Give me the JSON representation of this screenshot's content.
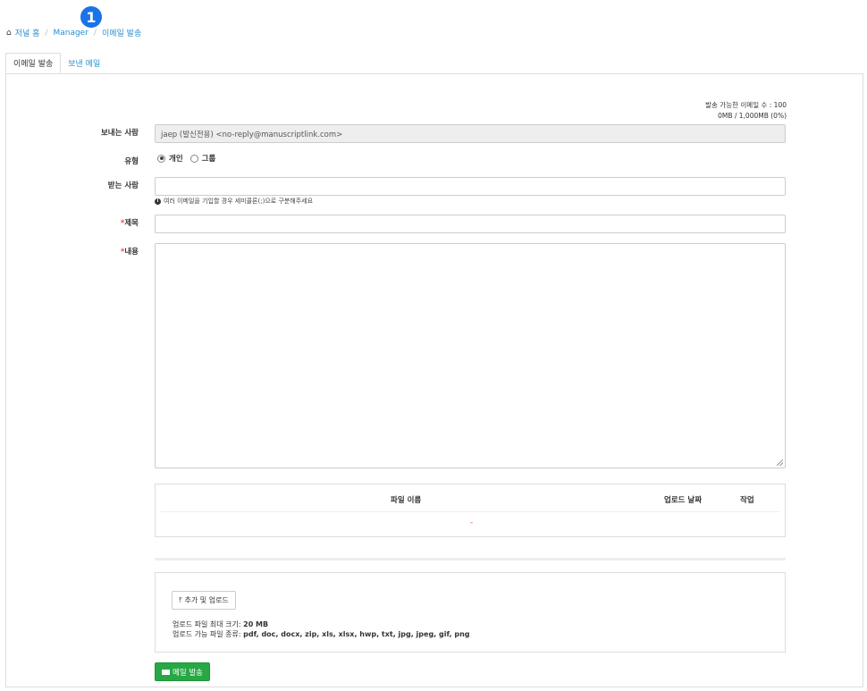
{
  "step_badge": "1",
  "breadcrumb": {
    "home": "저널 홈",
    "manager": "Manager",
    "current": "이메일 발송",
    "separator": "/"
  },
  "tabs": [
    {
      "label": "이메일 발송",
      "active": true
    },
    {
      "label": "보낸 메일",
      "active": false
    }
  ],
  "quota": {
    "emails": "발송 가능한 이메일 수 : 100",
    "storage": "0MB / 1,000MB (0%)"
  },
  "form": {
    "sender_label": "보내는 사람",
    "sender_value": "jaep (발신전용) <no-reply@manuscriptlink.com>",
    "type_label": "유형",
    "type_options": [
      "개인",
      "그룹"
    ],
    "type_selected": "개인",
    "recipient_label": "받는 사람",
    "recipient_hint": "여러 이메일을 기입할 경우 세미콜론(;)으로 구분해주세요",
    "required_mark": "*",
    "subject_label": "제목",
    "content_label": "내용"
  },
  "files_table": {
    "headers": [
      "파일 이름",
      "업로드 날짜",
      "작업"
    ],
    "empty_marker": "-"
  },
  "upload": {
    "button_label": "추가 및 업로드",
    "max_size_label": "업로드 파일 최대 크기:",
    "max_size_value": "20 MB",
    "types_label": "업로드 가능 파일 종류:",
    "types_value": "pdf, doc, docx, zip, xls, xlsx, hwp, txt, jpg, jpeg, gif, png"
  },
  "send_button": "메일 발송",
  "colors": {
    "link": "#2a8fd0",
    "badge": "#1a73e8",
    "send_button": "#28a745",
    "required": "#d9534f"
  }
}
